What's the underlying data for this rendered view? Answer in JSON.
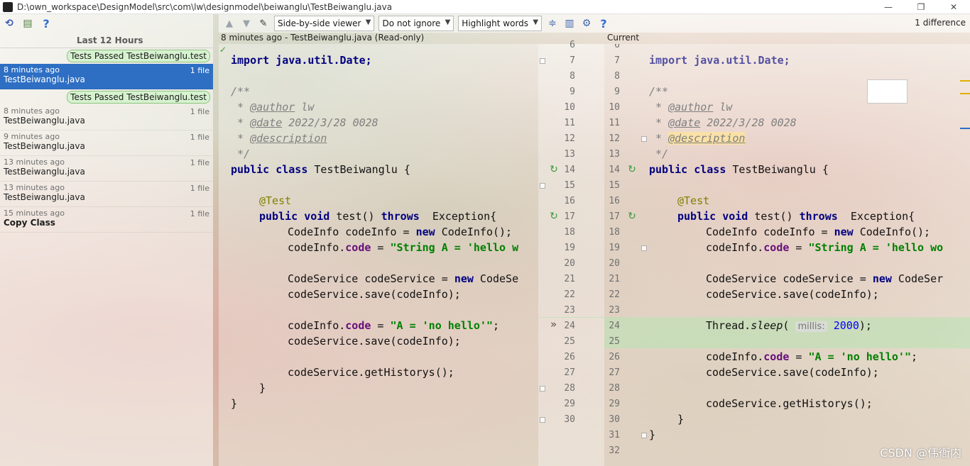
{
  "window": {
    "title": "D:\\own_workspace\\DesignModel\\src\\com\\lw\\designmodel\\beiwanglu\\TestBeiwanglu.java",
    "buttons": [
      "—",
      "❐",
      "✕"
    ]
  },
  "left_toolbar": {
    "icons": [
      "revert-icon",
      "patch-icon",
      "help-icon"
    ],
    "help_glyph": "?"
  },
  "history": {
    "group_header": "Last 12 Hours",
    "labels": [
      "Tests Passed TestBeiwanglu.test",
      "Tests Passed TestBeiwanglu.test"
    ],
    "revisions": [
      {
        "time": "8 minutes ago",
        "files": "1 file",
        "name": "TestBeiwanglu.java",
        "selected": true
      },
      {
        "time": "8 minutes ago",
        "files": "1 file",
        "name": "TestBeiwanglu.java",
        "selected": false
      },
      {
        "time": "9 minutes ago",
        "files": "1 file",
        "name": "TestBeiwanglu.java",
        "selected": false
      },
      {
        "time": "13 minutes ago",
        "files": "1 file",
        "name": "TestBeiwanglu.java",
        "selected": false
      },
      {
        "time": "13 minutes ago",
        "files": "1 file",
        "name": "TestBeiwanglu.java",
        "selected": false
      },
      {
        "time": "15 minutes ago",
        "files": "1 file",
        "name": "Copy Class",
        "selected": false
      }
    ]
  },
  "diff_toolbar": {
    "viewer": "Side-by-side viewer",
    "ignore": "Do not ignore",
    "highlight": "Highlight words",
    "difference_count": "1 difference",
    "help_glyph": "?"
  },
  "left_header": "8 minutes ago - TestBeiwanglu.java (Read-only)",
  "right_header": "Current",
  "left_code": {
    "l1": "import java.util.Date;",
    "l3": "/**",
    "l4_tag": "@author",
    "l4_val": " lw",
    "l5_tag": "@date",
    "l5_val": " 2022/3/28 0028",
    "l6_tag": "@description",
    "l7": " */",
    "l8_kw": "public class",
    "l8_name": " TestBeiwanglu {",
    "l10": "@Test",
    "l11_kw": "public void",
    "l11_mid": " test() ",
    "l11_kw2": "throws",
    "l11_rest": "  Exception{",
    "l12_a": "CodeInfo codeInfo = ",
    "l12_kw": "new",
    "l12_b": " CodeInfo();",
    "l13_a": "codeInfo.",
    "l13_fld": "code",
    "l13_b": " = ",
    "l13_str": "\"String A = 'hello w",
    "l15_a": "CodeService codeService = ",
    "l15_kw": "new",
    "l15_b": " CodeSe",
    "l16": "codeService.save(codeInfo);",
    "l18_a": "codeInfo.",
    "l18_fld": "code",
    "l18_b": " = ",
    "l18_str": "\"A = 'no hello'\"",
    "l18_c": ";",
    "l19": "codeService.save(codeInfo);",
    "l21": "codeService.getHistorys();",
    "l22": "}",
    "l23": "}"
  },
  "right_code": {
    "l1": "import java.util.Date;",
    "l3": "/**",
    "l4_tag": "@author",
    "l4_val": " lw",
    "l5_tag": "@date",
    "l5_val": " 2022/3/28 0028",
    "l6_tag": "@description",
    "l7": " */",
    "l8_kw": "public class",
    "l8_name": " TestBeiwanglu {",
    "l10": "@Test",
    "l11_kw": "public void",
    "l11_mid": " test() ",
    "l11_kw2": "throws",
    "l11_rest": "  Exception{",
    "l12_a": "CodeInfo codeInfo = ",
    "l12_kw": "new",
    "l12_b": " CodeInfo();",
    "l13_a": "codeInfo.",
    "l13_fld": "code",
    "l13_b": " = ",
    "l13_str": "\"String A = 'hello wo",
    "l15_a": "CodeService codeService = ",
    "l15_kw": "new",
    "l15_b": " CodeSer",
    "l16": "codeService.save(codeInfo);",
    "l18_a": "Thread.",
    "l18_sleep": "sleep",
    "l18_b": "( ",
    "l18_hint": "millis:",
    "l18_num": " 2000",
    "l18_c": ");",
    "l20_a": "codeInfo.",
    "l20_fld": "code",
    "l20_b": " = ",
    "l20_str": "\"A = 'no hello'\"",
    "l20_c": ";",
    "l21": "codeService.save(codeInfo);",
    "l23": "codeService.getHistorys();",
    "l24": "}",
    "l25": "}"
  },
  "left_line_numbers": [
    "6",
    "7",
    "8",
    "9",
    "10",
    "11",
    "12",
    "13",
    "14",
    "15",
    "16",
    "17",
    "18",
    "19",
    "20",
    "21",
    "22",
    "23",
    "24",
    "25",
    "26",
    "27",
    "28",
    "29",
    "30"
  ],
  "right_line_numbers": [
    "6",
    "7",
    "8",
    "9",
    "10",
    "11",
    "12",
    "13",
    "14",
    "15",
    "16",
    "17",
    "18",
    "19",
    "20",
    "21",
    "22",
    "23",
    "24",
    "25",
    "26",
    "27",
    "28",
    "29",
    "30",
    "31",
    "32"
  ],
  "apply_glyph": "»",
  "watermark": "CSDN @伟衙内",
  "colors": {
    "accent": "#2e6fc4",
    "changed": "#90d688"
  }
}
